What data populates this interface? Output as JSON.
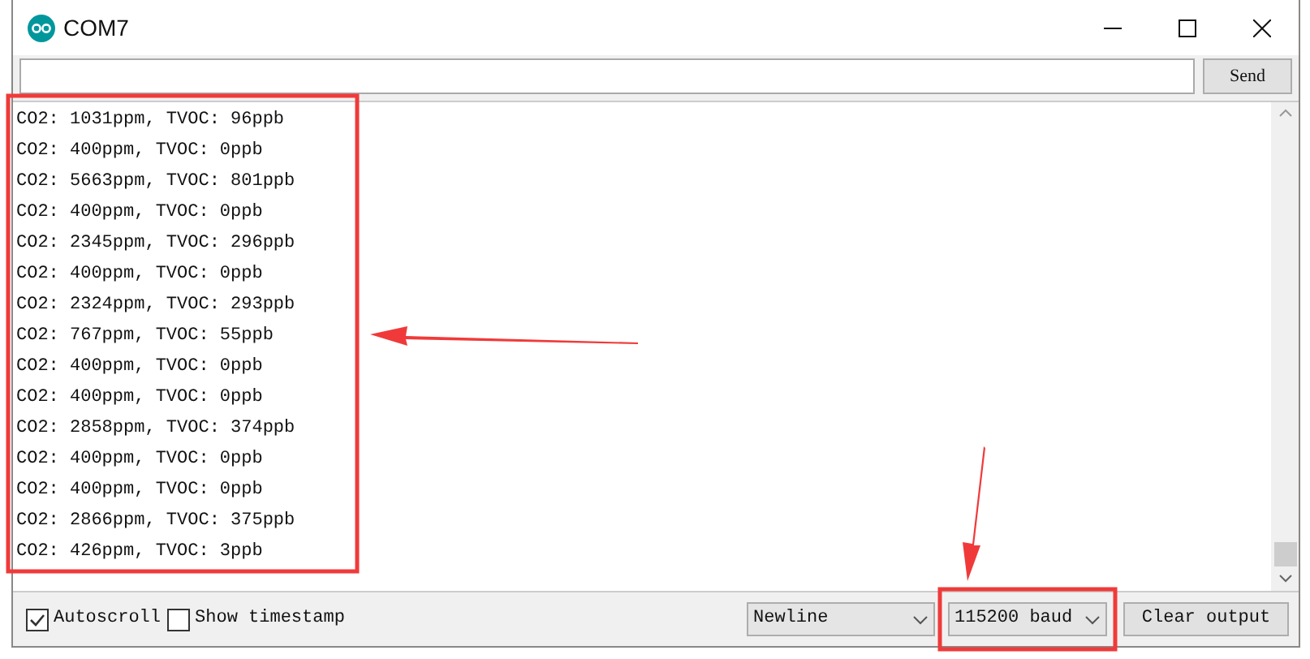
{
  "window": {
    "title": "COM7"
  },
  "send_button": "Send",
  "output_lines": [
    "CO2: 1031ppm, TVOC: 96ppb",
    "CO2: 400ppm, TVOC: 0ppb",
    "CO2: 5663ppm, TVOC: 801ppb",
    "CO2: 400ppm, TVOC: 0ppb",
    "CO2: 2345ppm, TVOC: 296ppb",
    "CO2: 400ppm, TVOC: 0ppb",
    "CO2: 2324ppm, TVOC: 293ppb",
    "CO2: 767ppm, TVOC: 55ppb",
    "CO2: 400ppm, TVOC: 0ppb",
    "CO2: 400ppm, TVOC: 0ppb",
    "CO2: 2858ppm, TVOC: 374ppb",
    "CO2: 400ppm, TVOC: 0ppb",
    "CO2: 400ppm, TVOC: 0ppb",
    "CO2: 2866ppm, TVOC: 375ppb",
    "CO2: 426ppm, TVOC: 3ppb"
  ],
  "options": [
    {
      "label": "Autoscroll",
      "checked": true
    },
    {
      "label": "Show timestamp",
      "checked": false
    }
  ],
  "line_ending": "Newline",
  "baud_rate": "115200 baud",
  "clear_button": "Clear output"
}
